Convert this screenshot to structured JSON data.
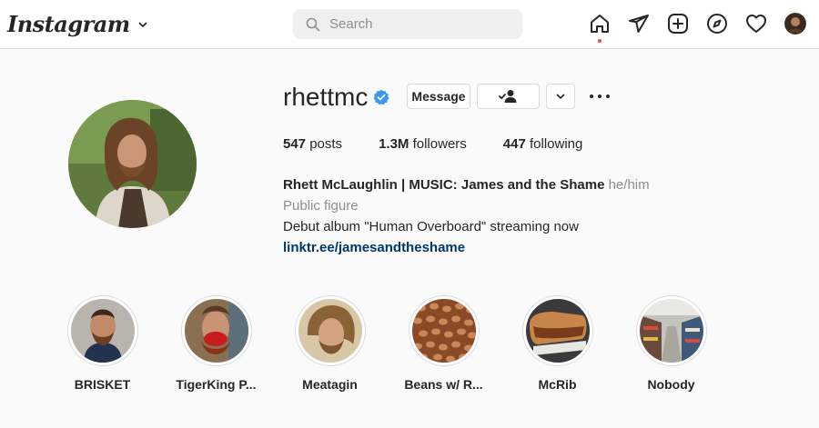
{
  "app": {
    "logo_text": "Instagram",
    "search_placeholder": "Search"
  },
  "nav": {
    "icons": [
      "home-icon",
      "direct-icon",
      "new-post-icon",
      "explore-icon",
      "activity-icon",
      "profile-avatar"
    ]
  },
  "profile": {
    "username": "rhettmc",
    "verified": true,
    "message_label": "Message",
    "stats": {
      "posts_count": "547",
      "posts_label": "posts",
      "followers_count": "1.3M",
      "followers_label": "followers",
      "following_count": "447",
      "following_label": "following"
    },
    "bio": {
      "full_name": "Rhett McLaughlin | MUSIC: James and the Shame",
      "pronouns": "he/him",
      "category": "Public figure",
      "text": "Debut album \"Human Overboard\" streaming now",
      "link": "linktr.ee/jamesandtheshame"
    }
  },
  "highlights": [
    {
      "label": "BRISKET"
    },
    {
      "label": "TigerKing P..."
    },
    {
      "label": "Meatagin"
    },
    {
      "label": "Beans w/ R..."
    },
    {
      "label": "McRib"
    },
    {
      "label": "Nobody"
    }
  ],
  "colors": {
    "background": "#fafafa",
    "verified_blue": "#3897f0",
    "link": "#00376b",
    "notification_dot": "#ed4956"
  }
}
